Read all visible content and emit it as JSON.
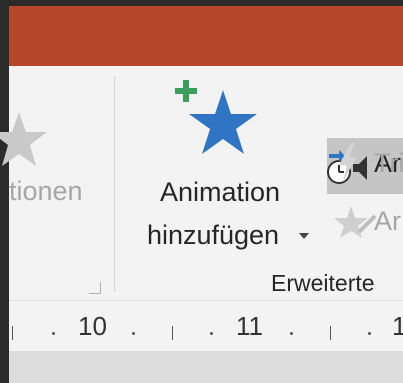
{
  "ribbon": {
    "partial_left_label": "tionen",
    "add_animation": {
      "label_line1": "Animation",
      "label_line2": "hinzufügen"
    },
    "advanced_group": {
      "animation_pane_label": "Ar",
      "trigger_label": "Tri",
      "animation_painter_label": "Ar",
      "group_title": "Erweiterte"
    }
  },
  "ruler": {
    "numbers": [
      "10",
      "11",
      "1"
    ]
  },
  "colors": {
    "title_bar": "#b7472a",
    "ribbon_bg": "#f3f3f3",
    "star_blue": "#2f75c4",
    "plus_green": "#3a9f5a",
    "highlight": "#c5c5c5"
  },
  "icons": {
    "add_animation": "star-plus-icon",
    "animation_pane": "clock-audio-icon",
    "trigger": "lightning-icon",
    "animation_painter": "star-brush-icon",
    "left_star": "star-icon"
  }
}
